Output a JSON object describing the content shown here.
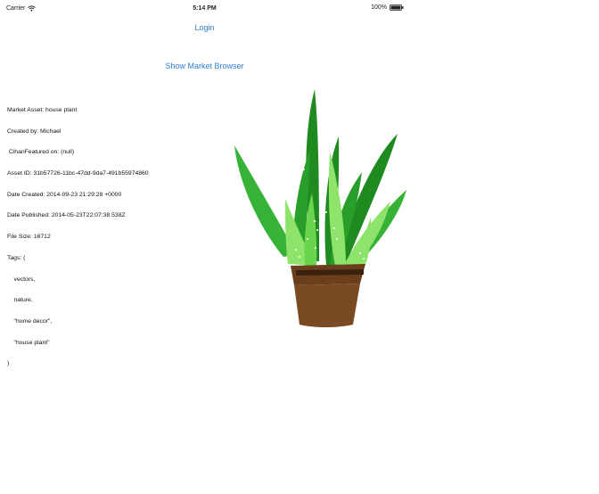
{
  "status_bar": {
    "carrier": "Carrier",
    "wifi_icon": "wifi-icon",
    "time": "5:14 PM",
    "battery": "100%",
    "battery_icon": "battery-icon"
  },
  "buttons": {
    "login": "Login",
    "show_market_browser": "Show Market Browser"
  },
  "asset_info": {
    "lines": [
      "Market Asset: house plant",
      "Created by: Michael",
      " CihanFeatured on: (null)",
      "Asset ID: 31b57726-11bc-47dd-9da7-491b55974860",
      "Date Created: 2014-09-23 21:29:28 +0000",
      "Date Published: 2014-05-23T22:07:38.538Z",
      "File Size: 16712",
      "Tags: (",
      "    vectors,",
      "    nature,",
      "    \"home decor\",",
      "    \"house plant\"",
      ")"
    ]
  },
  "image": {
    "name": "house-plant-image",
    "colors": {
      "pot": "#7a4a22",
      "pot_rim": "#6b3f1b",
      "soil": "#3a2210",
      "leaf_dark": "#1f8a1f",
      "leaf_mid": "#36b336",
      "leaf_light": "#8ee36a"
    }
  }
}
